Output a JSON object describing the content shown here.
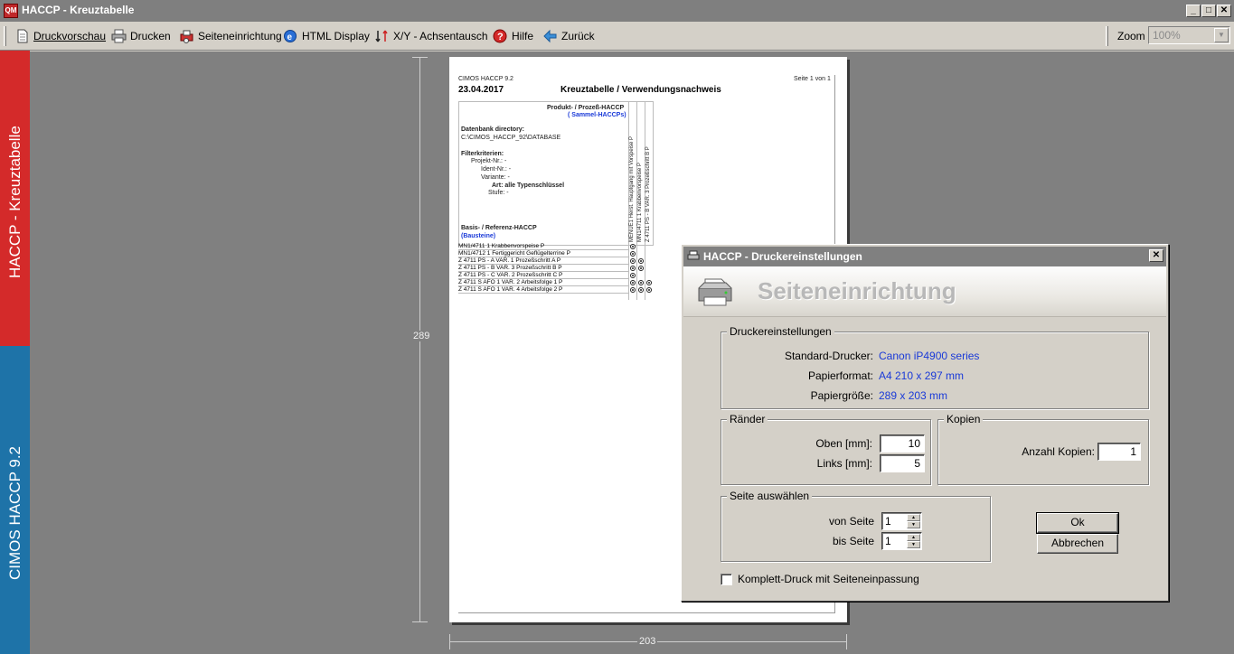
{
  "window": {
    "title": "HACCP - Kreuztabelle",
    "app_icon_text": "QM",
    "minimize": "_",
    "maximize": "□",
    "close": "✕"
  },
  "toolbar": {
    "items": [
      {
        "label": "Druckvorschau",
        "icon": "document-icon"
      },
      {
        "label": "Drucken",
        "icon": "printer-icon"
      },
      {
        "label": "Seiteneinrichtung",
        "icon": "page-setup-icon"
      },
      {
        "label": "HTML Display",
        "icon": "browser-icon"
      },
      {
        "label": "X/Y - Achsentausch",
        "icon": "swap-axes-icon"
      },
      {
        "label": "Hilfe",
        "icon": "help-icon"
      },
      {
        "label": "Zurück",
        "icon": "back-arrow-icon"
      }
    ],
    "zoom_label": "Zoom",
    "zoom_value": "100%"
  },
  "side": {
    "red_label": "HACCP - Kreuztabelle",
    "blue_label": "CIMOS HACCP 9.2",
    "red_color": "#d42a2a",
    "blue_color": "#1e73a8"
  },
  "preview": {
    "height_label": "289",
    "width_label": "203",
    "paper": {
      "app_version": "CIMOS HACCP 9.2",
      "page_info": "Seite 1 von 1",
      "date": "23.04.2017",
      "title": "Kreuztabelle / Verwendungsnachweis",
      "produkt_header": "Produkt- / Prozeß-HACCP",
      "sammel_header": "( Sammel-HACCPs)",
      "db_label": "Datenbank directory:",
      "db_path": "C:\\CIMOS_HACCP_92\\DATABASE",
      "filter_label": "Filterkriterien:",
      "filter_projekt": "Projekt-Nr.: -",
      "filter_ident": "Ident-Nr.: -",
      "filter_variante": "Variante: -",
      "filter_art": "Art: alle Typenschlüssel",
      "filter_stufe": "Stufe: -",
      "basis_label": "Basis- / Referenz-HACCP",
      "bausteine_label": "(Bausteine)",
      "columns": [
        "MENUE1  Herst. Hauptgang mit Vorspeise  P",
        "MN1/4711  1  Krabbenvorspeise  P",
        "Z 4711 PS - B  VAR. 3  Prozeßschritt B  P"
      ],
      "rows": [
        {
          "label": "MN1/4711  1  Krabbenvorspeise  P",
          "marks": 1
        },
        {
          "label": "MN1/4712  1  Fertiggericht Geflügelterrine  P",
          "marks": 1
        },
        {
          "label": "Z 4711 PS - A  VAR. 1  Prozeßschritt A  P",
          "marks": 2
        },
        {
          "label": "Z 4711 PS - B  VAR. 3  Prozeßschritt B  P",
          "marks": 2
        },
        {
          "label": "Z 4711 PS - C  VAR. 2  Prozeßschritt C  P",
          "marks": 1
        },
        {
          "label": "Z 4711 S AFO 1  VAR. 2  Arbeitsfolge 1  P",
          "marks": 3
        },
        {
          "label": "Z 4711 S AFO 1  VAR. 4  Arbeitsfolge 2  P",
          "marks": 3
        }
      ]
    }
  },
  "dialog": {
    "title": "HACCP - Druckereinstellungen",
    "close": "✕",
    "heading": "Seiteneinrichtung",
    "druckereinstellungen": {
      "legend": "Druckereinstellungen",
      "standard_label": "Standard-Drucker:",
      "standard_value": "Canon iP4900 series",
      "format_label": "Papierformat:",
      "format_value": "A4 210 x 297 mm",
      "groesse_label": "Papiergröße:",
      "groesse_value": "289 x 203 mm"
    },
    "raender": {
      "legend": "Ränder",
      "oben_label": "Oben [mm]:",
      "oben_value": "10",
      "links_label": "Links [mm]:",
      "links_value": "5"
    },
    "kopien": {
      "legend": "Kopien",
      "anzahl_label": "Anzahl Kopien:",
      "anzahl_value": "1"
    },
    "seite": {
      "legend": "Seite auswählen",
      "von_label": "von Seite",
      "von_value": "1",
      "bis_label": "bis Seite",
      "bis_value": "1"
    },
    "ok_label": "Ok",
    "cancel_label": "Abbrechen",
    "komplett_label": "Komplett-Druck mit Seiteneinpassung"
  }
}
